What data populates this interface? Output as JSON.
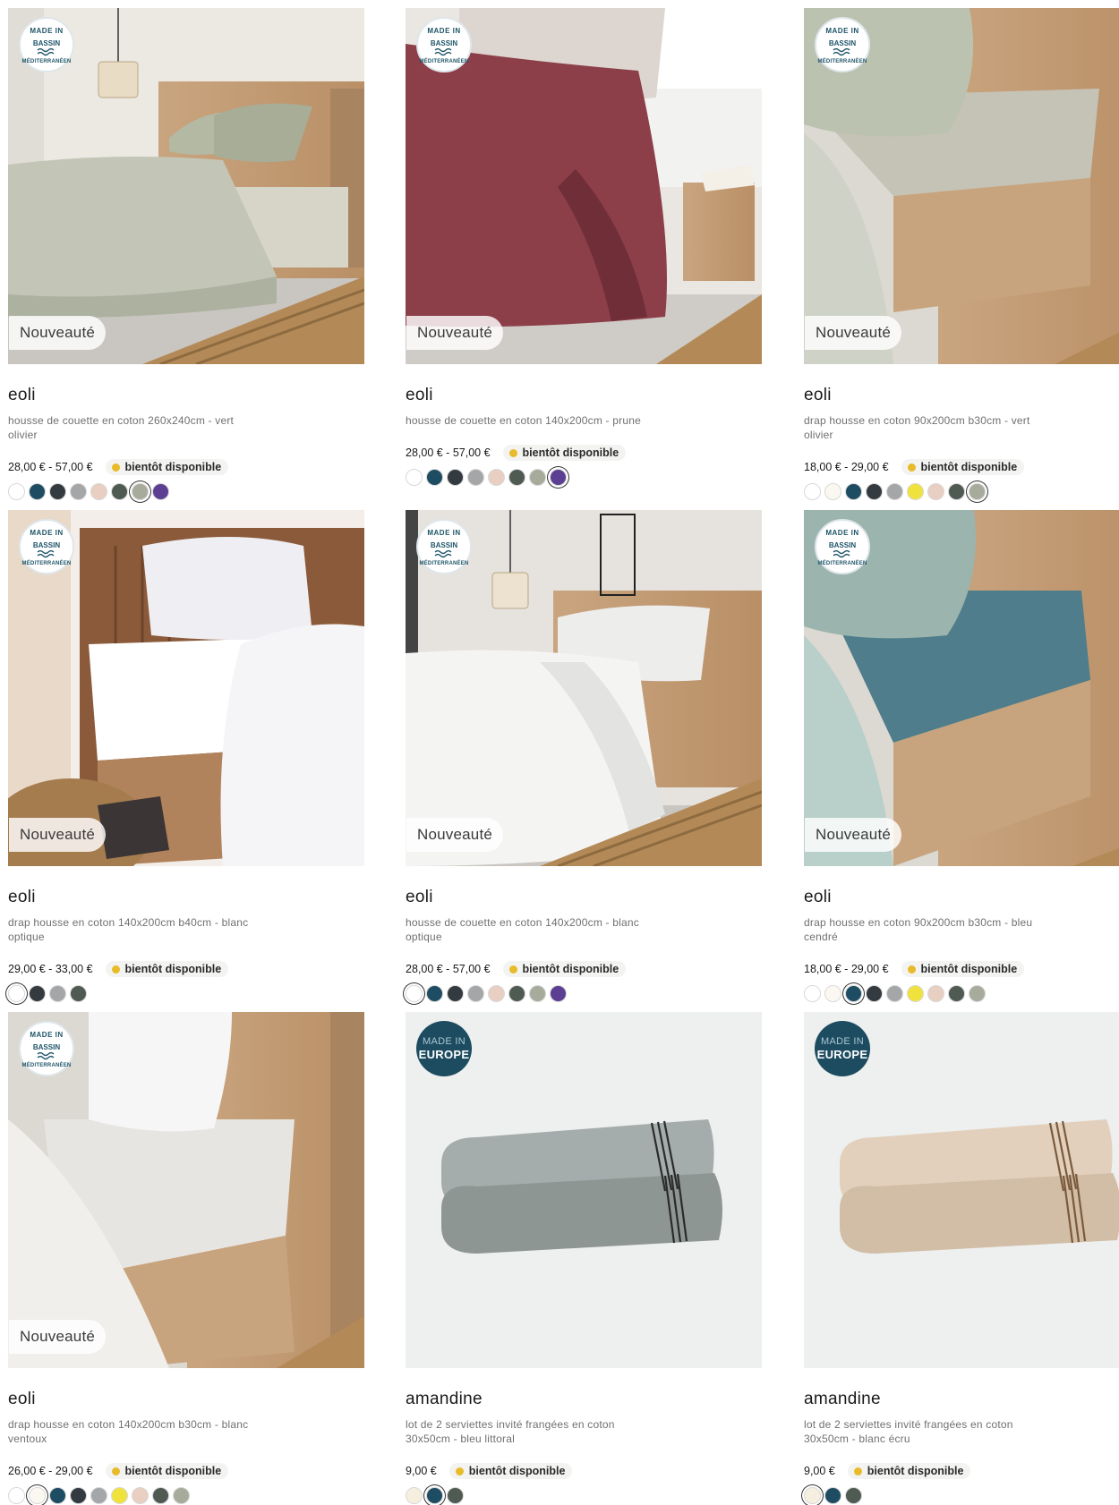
{
  "labels": {
    "new_badge": "Nouveauté",
    "availability": "bientôt disponible"
  },
  "seals": {
    "mediterranean": {
      "line1": "MADE IN",
      "line2": "BASSIN",
      "line3": "MÉDITERRANÉEN"
    },
    "europe": {
      "line1": "MADE IN",
      "line2": "EUROPE"
    }
  },
  "products": [
    {
      "brand": "eoli",
      "description": "housse de couette en coton 260x240cm - vert olivier",
      "price": "28,00 € - 57,00 €",
      "new": true,
      "seal": "mediterranean",
      "scene": "duvet-green",
      "swatches": [
        "#ffffff",
        "#1e4d63",
        "#333a40",
        "#a4a6a8",
        "#e8cfc2",
        "#4e5a52",
        "#a7ab9b",
        "#5c3f92"
      ],
      "selected": 6
    },
    {
      "brand": "eoli",
      "description": "housse de couette en coton 140x200cm - prune",
      "price": "28,00 € - 57,00 €",
      "new": true,
      "seal": "mediterranean",
      "scene": "duvet-prune",
      "swatches": [
        "#ffffff",
        "#1e4d63",
        "#333a40",
        "#a4a6a8",
        "#e8cfc2",
        "#4e5a52",
        "#a7ab9b",
        "#5c3f92"
      ],
      "selected": 7
    },
    {
      "brand": "eoli",
      "description": "drap housse en coton 90x200cm b30cm - vert olivier",
      "price": "18,00 € - 29,00 €",
      "new": true,
      "seal": "mediterranean",
      "scene": "sheet-green",
      "swatches": [
        "#ffffff",
        "#fbf8f1",
        "#1e4d63",
        "#333a40",
        "#a4a6a8",
        "#f0e23c",
        "#e8cfc2",
        "#4e5a52",
        "#a7ab9b"
      ],
      "selected": 8
    },
    {
      "brand": "eoli",
      "description": "drap housse en coton 140x200cm b40cm - blanc optique",
      "price": "29,00 € - 33,00 €",
      "new": true,
      "seal": "mediterranean",
      "scene": "sheet-white-dark",
      "swatches": [
        "#ffffff",
        "#333a40",
        "#a4a6a8",
        "#4e5a52"
      ],
      "selected": 0
    },
    {
      "brand": "eoli",
      "description": "housse de couette en coton 140x200cm - blanc optique",
      "price": "28,00 € - 57,00 €",
      "new": true,
      "seal": "mediterranean",
      "scene": "duvet-white",
      "swatches": [
        "#ffffff",
        "#1e4d63",
        "#333a40",
        "#a4a6a8",
        "#e8cfc2",
        "#4e5a52",
        "#a7ab9b",
        "#5c3f92"
      ],
      "selected": 0
    },
    {
      "brand": "eoli",
      "description": "drap housse en coton 90x200cm b30cm - bleu cendré",
      "price": "18,00 € - 29,00 €",
      "new": true,
      "seal": "mediterranean",
      "scene": "sheet-blue",
      "swatches": [
        "#ffffff",
        "#fbf8f1",
        "#1e4d63",
        "#333a40",
        "#a4a6a8",
        "#f0e23c",
        "#e8cfc2",
        "#4e5a52",
        "#a7ab9b"
      ],
      "selected": 2
    },
    {
      "brand": "eoli",
      "description": "drap housse en coton 140x200cm b30cm - blanc ventoux",
      "price": "26,00 € - 29,00 €",
      "new": true,
      "seal": "mediterranean",
      "scene": "sheet-white",
      "swatches": [
        "#ffffff",
        "#fbf8f1",
        "#1e4d63",
        "#333a40",
        "#a4a6a8",
        "#f0e23c",
        "#e8cfc2",
        "#4e5a52",
        "#a7ab9b"
      ],
      "selected": 1
    },
    {
      "brand": "amandine",
      "description": "lot de 2 serviettes invité frangées en coton 30x50cm - bleu littoral",
      "price": "9,00 €",
      "new": false,
      "seal": "europe",
      "scene": "towel-grey",
      "swatches": [
        "#f6efdf",
        "#1e4d63",
        "#4e5a52"
      ],
      "selected": 1
    },
    {
      "brand": "amandine",
      "description": "lot de 2 serviettes invité frangées en coton 30x50cm - blanc écru",
      "price": "9,00 €",
      "new": false,
      "seal": "europe",
      "scene": "towel-beige",
      "swatches": [
        "#f6efdf",
        "#1e4d63",
        "#4e5a52"
      ],
      "selected": 0
    }
  ]
}
